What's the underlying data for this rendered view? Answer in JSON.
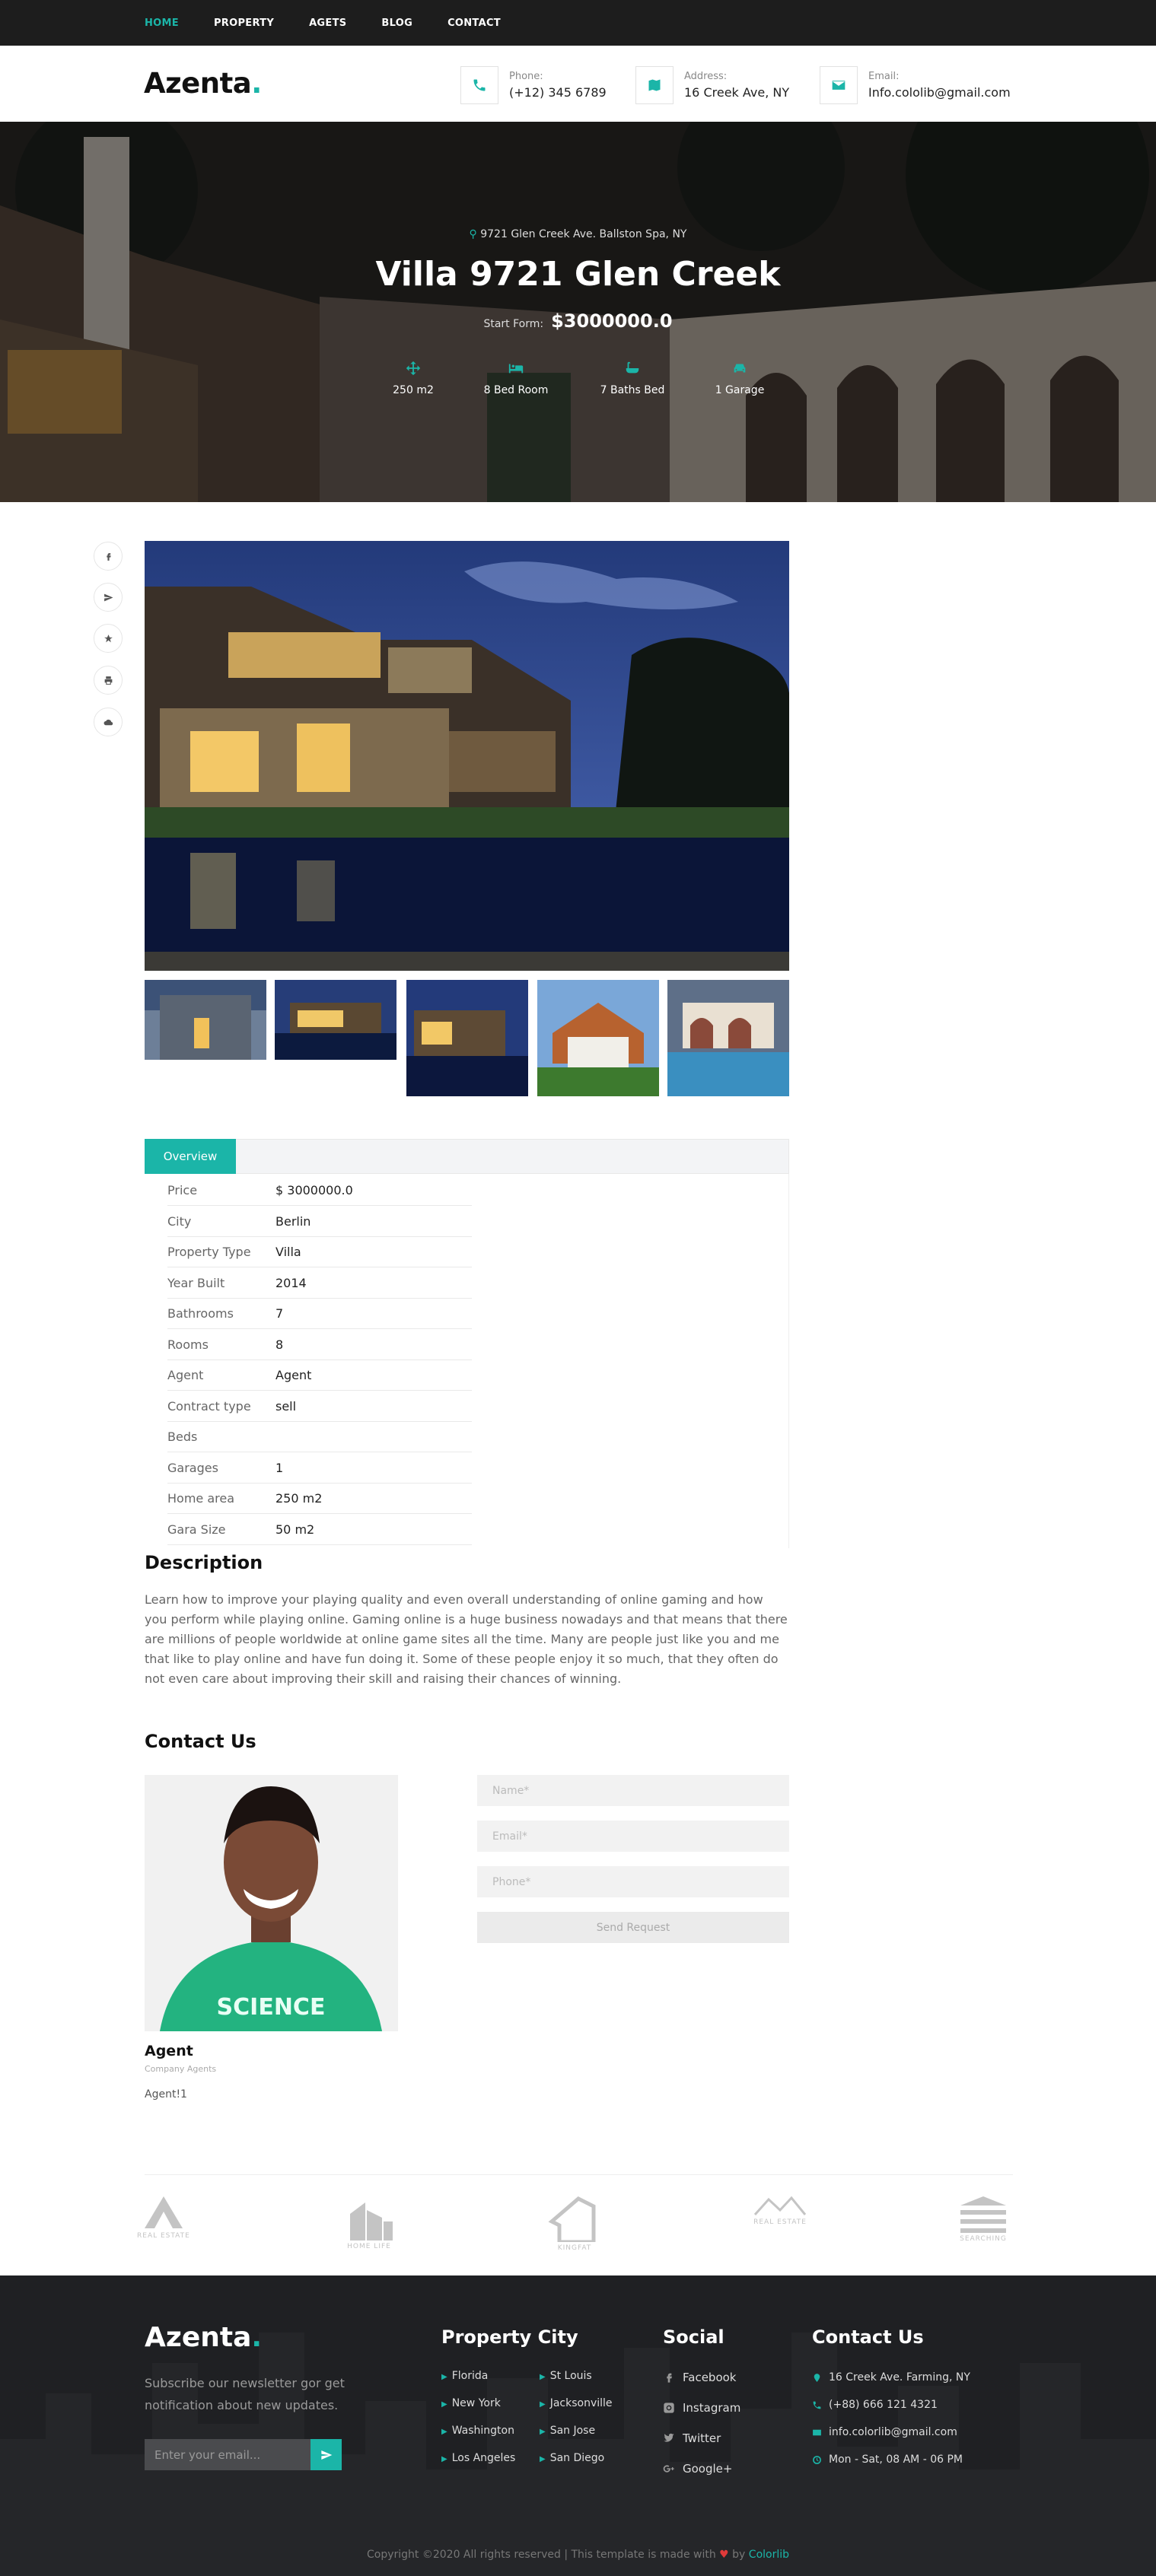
{
  "nav": {
    "items": [
      "HOME",
      "PROPERTY",
      "AGETS",
      "BLOG",
      "CONTACT"
    ]
  },
  "header": {
    "logo": "Azenta",
    "logo_dot": ".",
    "phone": {
      "label": "Phone:",
      "value": "(+12) 345 6789",
      "icon": "phone-icon"
    },
    "address": {
      "label": "Address:",
      "value": "16 Creek Ave, NY",
      "icon": "map-icon"
    },
    "email": {
      "label": "Email:",
      "value": "Info.cololib@gmail.com",
      "icon": "envelope-icon"
    }
  },
  "hero": {
    "location": "9721 Glen Creek Ave. Ballston Spa, NY",
    "title": "Villa 9721 Glen Creek",
    "price_label": "Start Form:",
    "price": "$3000000.0",
    "features": [
      "250 m2",
      "8 Bed Room",
      "7 Baths Bed",
      "1 Garage"
    ]
  },
  "share_icons": [
    "facebook-icon",
    "send-icon",
    "star-icon",
    "print-icon",
    "cloud-download-icon"
  ],
  "overview": {
    "tab": "Overview",
    "rows": [
      {
        "k": "Price",
        "v": "$ 3000000.0"
      },
      {
        "k": "City",
        "v": "Berlin"
      },
      {
        "k": "Property Type",
        "v": "Villa"
      },
      {
        "k": "Year Built",
        "v": "2014"
      },
      {
        "k": "Bathrooms",
        "v": "7"
      },
      {
        "k": "Rooms",
        "v": "8"
      },
      {
        "k": "Agent",
        "v": "Agent"
      },
      {
        "k": "Contract type",
        "v": "sell"
      },
      {
        "k": "Beds",
        "v": ""
      },
      {
        "k": "Garages",
        "v": "1"
      },
      {
        "k": "Home area",
        "v": "250 m2"
      },
      {
        "k": "Gara Size",
        "v": "50 m2"
      }
    ]
  },
  "description": {
    "heading": "Description",
    "text": "Learn how to improve your playing quality and even overall understanding of online gaming and how you perform while playing online. Gaming online is a huge business nowadays and that means that there are millions of people worldwide at online game sites all the time. Many are people just like you and me that like to play online and have fun doing it. Some of these people enjoy it so much, that they often do not even care about improving their skill and raising their chances of winning."
  },
  "contact": {
    "heading": "Contact Us",
    "agent_name": "Agent",
    "agent_role": "Company Agents",
    "agent_note": "Agent!1",
    "name_ph": "Name*",
    "email_ph": "Email*",
    "phone_ph": "Phone*",
    "send": "Send Request"
  },
  "partners": [
    "REAL ESTATE",
    "HOME LIFE",
    "KINGFAT",
    "REAL ESTATE",
    "SEARCHING"
  ],
  "footer": {
    "logo": "Azenta",
    "logo_dot": ".",
    "newsletter": "Subscribe our newsletter gor get notification about new updates.",
    "email_ph": "Enter your email...",
    "city_heading": "Property City",
    "cities_left": [
      "Florida",
      "New York",
      "Washington",
      "Los Angeles"
    ],
    "cities_right": [
      "St Louis",
      "Jacksonville",
      "San Jose",
      "San Diego"
    ],
    "social_heading": "Social",
    "social": [
      "Facebook",
      "Instagram",
      "Twitter",
      "Google+"
    ],
    "contact_heading": "Contact Us",
    "contacts": [
      "16 Creek Ave. Farming, NY",
      "(+88) 666 121 4321",
      "info.colorlib@gmail.com",
      "Mon - Sat, 08 AM - 06 PM"
    ],
    "copyright_a": "Copyright ©2020 All rights reserved | This template is made with",
    "copyright_heart": "♥",
    "copyright_by": "by",
    "copyright_brand": "Colorlib"
  },
  "colors": {
    "accent": "#1bb5a8",
    "topbar": "#1d1d1d",
    "footer": "#1f2023"
  }
}
